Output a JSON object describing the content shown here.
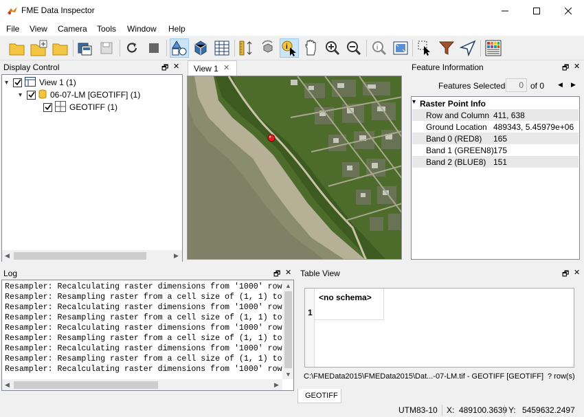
{
  "window": {
    "title": "FME Data Inspector",
    "minimize": "—",
    "maximize": "☐",
    "close": "✕"
  },
  "menu": [
    "File",
    "View",
    "Camera",
    "Tools",
    "Window",
    "Help"
  ],
  "toolbar_icons": [
    "open-folder-icon",
    "add-dataset-icon",
    "folder-icon",
    "save-view-icon",
    "save-icon",
    "refresh-icon",
    "stop-icon",
    "2d-view-icon",
    "3d-view-icon",
    "table-icon",
    "measure-icon",
    "orbit-icon",
    "inspect-select-icon",
    "pan-hand-icon",
    "zoom-in-icon",
    "zoom-out-icon",
    "query-icon",
    "zoom-extent-icon",
    "select-icon",
    "filter-icon",
    "navigate-icon",
    "background-map-icon"
  ],
  "display_control": {
    "title": "Display Control",
    "tree": [
      {
        "label": "View 1 (1)",
        "level": 0
      },
      {
        "label": "06-07-LM [GEOTIFF] (1)",
        "level": 1
      },
      {
        "label": "GEOTIFF (1)",
        "level": 2
      }
    ]
  },
  "view_tab": {
    "label": "View 1",
    "close": "✕"
  },
  "feature_info": {
    "title": "Feature Information",
    "features_selected_label": "Features Selected:",
    "features_selected_value": "0",
    "of_label": "of 0",
    "section": "Raster Point Info",
    "rows": [
      {
        "key": "Row and Column",
        "value": "411, 638"
      },
      {
        "key": "Ground Location",
        "value": "489343, 5.45979e+06"
      },
      {
        "key": "Band 0 (RED8)",
        "value": "165"
      },
      {
        "key": "Band 1 (GREEN8)",
        "value": "175"
      },
      {
        "key": "Band 2 (BLUE8)",
        "value": "151"
      }
    ]
  },
  "log": {
    "title": "Log",
    "lines": [
      "Resampler: Recalculating raster dimensions from '1000' row",
      "Resampler: Resampling raster from a cell size of (1, 1) to",
      "Resampler: Recalculating raster dimensions from '1000' row",
      "Resampler: Resampling raster from a cell size of (1, 1) to",
      "Resampler: Recalculating raster dimensions from '1000' row",
      "Resampler: Resampling raster from a cell size of (1, 1) to",
      "Resampler: Recalculating raster dimensions from '1000' row",
      "Resampler: Resampling raster from a cell size of (1, 1) to",
      "Resampler: Recalculating raster dimensions from '1000' row"
    ]
  },
  "table_view": {
    "title": "Table View",
    "header": "<no schema>",
    "row_number": "1",
    "path": "C:\\FMEData2015\\FMEData2015\\Dat...-07-LM.tif - GEOTIFF [GEOTIFF]",
    "rows_count": "? row(s)",
    "tab": "GEOTIFF"
  },
  "status": {
    "crs": "UTM83-10",
    "x_label": "X:",
    "x_value": "489100.3639",
    "y_label": "Y:",
    "y_value": "5459632.2497"
  },
  "dock_controls": {
    "float": "🗗",
    "close": "✕"
  }
}
